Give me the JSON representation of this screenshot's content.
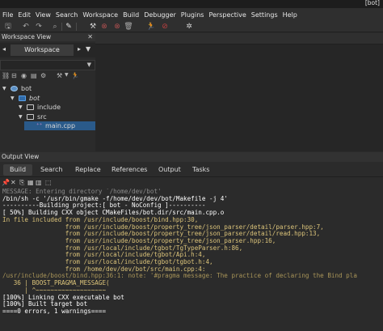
{
  "window": {
    "title": "[bot]"
  },
  "menu": [
    "File",
    "Edit",
    "View",
    "Search",
    "Workspace",
    "Build",
    "Debugger",
    "Plugins",
    "Perspective",
    "Settings",
    "Help"
  ],
  "workspace": {
    "title": "Workspace View",
    "close_glyph": "✕",
    "tab_label": "Workspace",
    "tree": [
      {
        "label": "bot",
        "level": 0,
        "kind": "workspace"
      },
      {
        "label": "bot",
        "level": 1,
        "kind": "project"
      },
      {
        "label": "include",
        "level": 2,
        "kind": "folder"
      },
      {
        "label": "src",
        "level": 2,
        "kind": "folder"
      },
      {
        "label": "main.cpp",
        "level": 3,
        "kind": "file",
        "selected": true
      }
    ]
  },
  "output": {
    "title": "Output View",
    "tabs": [
      "Build",
      "Search",
      "Replace",
      "References",
      "Output",
      "Tasks"
    ],
    "active_tab": "Build",
    "lines": [
      {
        "text": "MESSAGE: Entering directory `/home/dev/bot'",
        "style": "msg"
      },
      {
        "text": "/bin/sh -c '/usr/bin/gmake -f/home/dev/dev/bot/Makefile -j 4'",
        "style": "norm"
      },
      {
        "text": "----------Building project:[ bot - NoConfig ]----------",
        "style": "norm"
      },
      {
        "text": "[ 50%] Building CXX object CMakeFiles/bot.dir/src/main.cpp.o",
        "style": "norm"
      },
      {
        "text": "In file included from /usr/include/boost/bind.hpp:30,",
        "style": "warn"
      },
      {
        "text": "                 from /usr/include/boost/property_tree/json_parser/detail/parser.hpp:7,",
        "style": "warn"
      },
      {
        "text": "                 from /usr/include/boost/property_tree/json_parser/detail/read.hpp:13,",
        "style": "warn"
      },
      {
        "text": "                 from /usr/include/boost/property_tree/json_parser.hpp:16,",
        "style": "warn"
      },
      {
        "text": "                 from /usr/local/include/tgbot/TgTypeParser.h:86,",
        "style": "warn"
      },
      {
        "text": "                 from /usr/local/include/tgbot/Api.h:4,",
        "style": "warn"
      },
      {
        "text": "                 from /usr/local/include/tgbot/tgbot.h:4,",
        "style": "warn"
      },
      {
        "text": "                 from /home/dev/dev/bot/src/main.cpp:4:",
        "style": "warn"
      },
      {
        "text": "/usr/include/boost/bind.hpp:36:1: note: '#pragma message: The practice of declaring the Bind pla",
        "style": "dim"
      },
      {
        "text": "   36 | BOOST_PRAGMA_MESSAGE(",
        "style": "warn"
      },
      {
        "text": "      | ^~~~~~~~~~~~~~~~~~~~",
        "style": "warn"
      },
      {
        "text": "[100%] Linking CXX executable bot",
        "style": "norm"
      },
      {
        "text": "[100%] Built target bot",
        "style": "norm"
      },
      {
        "text": "====0 errors, 1 warnings====",
        "style": "norm"
      }
    ]
  }
}
